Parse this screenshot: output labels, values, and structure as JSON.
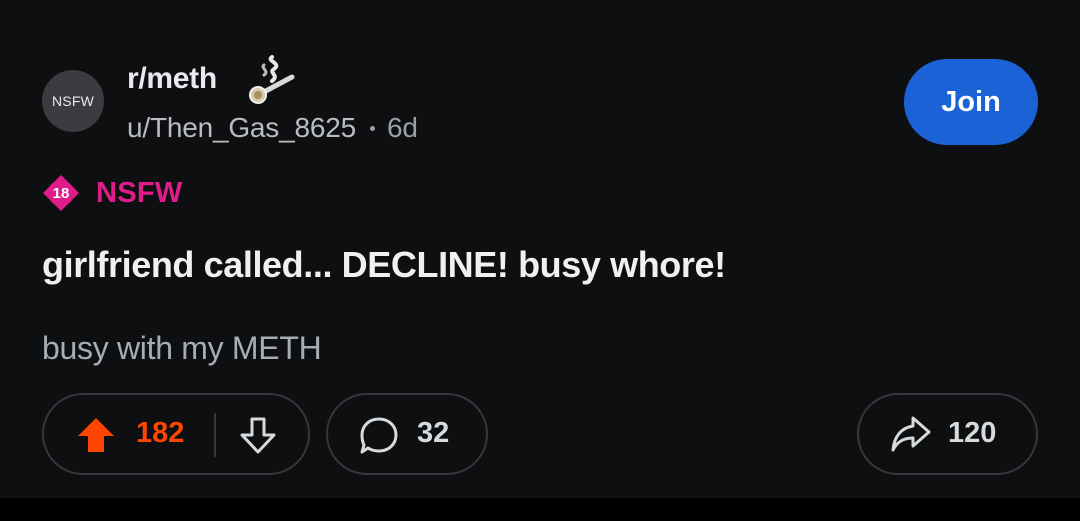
{
  "post": {
    "avatar_label": "NSFW",
    "subreddit": "r/meth",
    "author": "u/Then_Gas_8625",
    "age": "6d",
    "join_label": "Join",
    "nsfw_badge_number": "18",
    "nsfw_label": "NSFW",
    "title": "girlfriend called... DECLINE! busy whore!",
    "body": "busy with my METH"
  },
  "actions": {
    "upvotes": "182",
    "comments": "32",
    "shares": "120"
  },
  "colors": {
    "background": "#0e0f11",
    "join_button": "#1a62d6",
    "nsfw_accent": "#e01b8a",
    "upvote_active": "#ff4500",
    "pill_border": "#34373b"
  },
  "icons": {
    "subreddit": "pipe-smoke-icon",
    "nsfw": "nsfw-18-badge-icon",
    "upvote": "arrow-up-icon",
    "downvote": "arrow-down-icon",
    "comment": "speech-bubble-icon",
    "share": "share-arrow-icon"
  }
}
